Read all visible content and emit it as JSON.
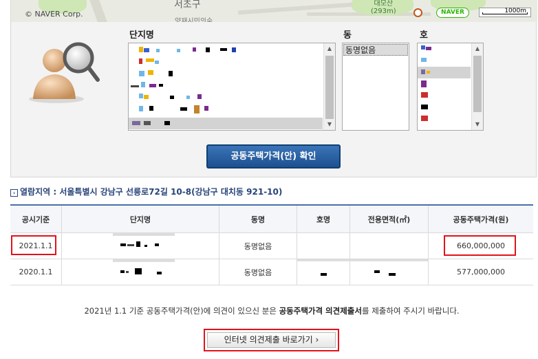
{
  "map": {
    "copyright": "© NAVER Corp.",
    "place_label": "서초구",
    "sub_label": "양재시민의숲",
    "mountain_name": "대모산",
    "mountain_height": "(293m)",
    "logo": "NAVER",
    "scale_label": "1000m"
  },
  "selector": {
    "complex_label": "단지명",
    "dong_label": "동",
    "ho_label": "호",
    "dong_item": "동명없음"
  },
  "confirm_button": "공동주택가격(안) 확인",
  "location": {
    "prefix": "열람지역 : ",
    "address": "서울특별시 강남구 선릉로72길 10-8(강남구 대치동 921-10)"
  },
  "table": {
    "headers": [
      "공시기준",
      "단지명",
      "동명",
      "호명",
      "전용면적(㎡)",
      "공동주택가격(원)"
    ],
    "rows": [
      {
        "date": "2021.1.1",
        "dong": "동명없음",
        "price": "660,000,000"
      },
      {
        "date": "2020.1.1",
        "dong": "동명없음",
        "price": "577,000,000"
      }
    ]
  },
  "notice": {
    "part1": "2021년 1.1 기준 공동주택가격(안)에 의견이 있으신 분은 ",
    "bold": "공동주택가격 의견제출서",
    "part2": "를 제출하여 주시기 바랍니다."
  },
  "opinion_button": "인터넷 의견제출 바로가기  ›",
  "colors": {
    "accent_blue": "#27447a",
    "highlight_red": "#e0121b",
    "button_blue": "#1e508f"
  }
}
